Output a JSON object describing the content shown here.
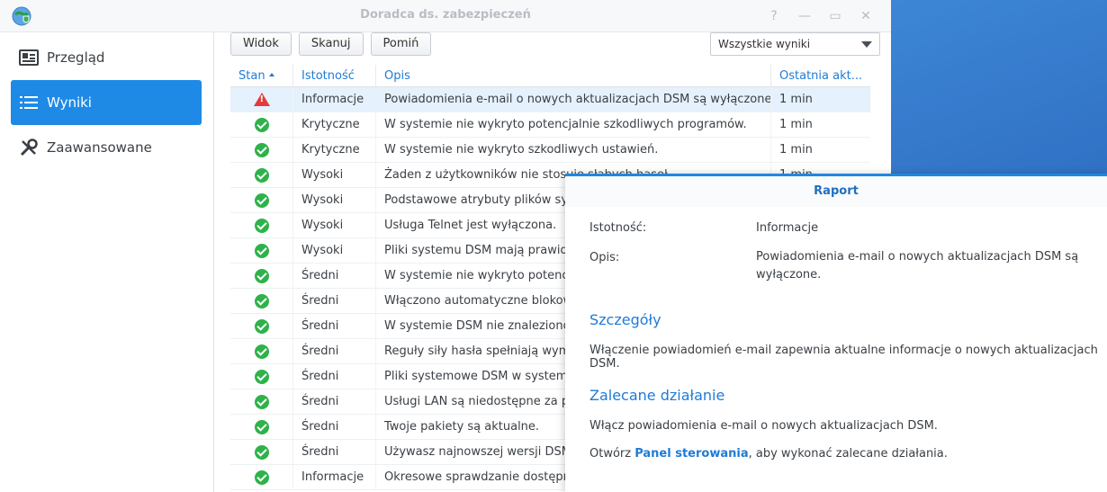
{
  "window": {
    "title": "Doradca ds. zabezpieczeń"
  },
  "sidebar": {
    "items": [
      {
        "label": "Przegląd",
        "icon": "overview-card-icon",
        "active": false
      },
      {
        "label": "Wyniki",
        "icon": "list-icon",
        "active": true
      },
      {
        "label": "Zaawansowane",
        "icon": "tools-icon",
        "active": false
      }
    ]
  },
  "toolbar": {
    "view_label": "Widok",
    "scan_label": "Skanuj",
    "skip_label": "Pomiń",
    "filter_value": "Wszystkie wyniki"
  },
  "table": {
    "headers": [
      "Stan",
      "Istotność",
      "Opis",
      "Ostatnia akt..."
    ],
    "rows": [
      {
        "status": "warning",
        "severity": "Informacje",
        "description": "Powiadomienia e-mail o nowych aktualizacjach DSM są wyłączone.",
        "last": "1 min"
      },
      {
        "status": "ok",
        "severity": "Krytyczne",
        "description": "W systemie nie wykryto potencjalnie szkodliwych programów.",
        "last": "1 min"
      },
      {
        "status": "ok",
        "severity": "Krytyczne",
        "description": "W systemie nie wykryto szkodliwych ustawień.",
        "last": "1 min"
      },
      {
        "status": "ok",
        "severity": "Wysoki",
        "description": "Żaden z użytkowników nie stosuje słabych haseł.",
        "last": "1 min"
      },
      {
        "status": "ok",
        "severity": "Wysoki",
        "description": "Podstawowe atrybuty plików systemowych",
        "last": ""
      },
      {
        "status": "ok",
        "severity": "Wysoki",
        "description": "Usługa Telnet jest wyłączona.",
        "last": ""
      },
      {
        "status": "ok",
        "severity": "Wysoki",
        "description": "Pliki systemu DSM mają prawidło",
        "last": ""
      },
      {
        "status": "ok",
        "severity": "Średni",
        "description": "W systemie nie wykryto potencja",
        "last": ""
      },
      {
        "status": "ok",
        "severity": "Średni",
        "description": "Włączono automatyczne blokowa",
        "last": ""
      },
      {
        "status": "ok",
        "severity": "Średni",
        "description": "W systemie DSM nie znaleziono",
        "last": ""
      },
      {
        "status": "ok",
        "severity": "Średni",
        "description": "Reguły siły hasła spełniają wymag",
        "last": ""
      },
      {
        "status": "ok",
        "severity": "Średni",
        "description": "Pliki systemowe DSM w systemow",
        "last": ""
      },
      {
        "status": "ok",
        "severity": "Średni",
        "description": "Usługi LAN są niedostępne za po",
        "last": ""
      },
      {
        "status": "ok",
        "severity": "Średni",
        "description": "Twoje pakiety są aktualne.",
        "last": ""
      },
      {
        "status": "ok",
        "severity": "Średni",
        "description": "Używasz najnowszej wersji DSM",
        "last": ""
      },
      {
        "status": "ok",
        "severity": "Informacje",
        "description": "Okresowe sprawdzanie dostępno",
        "last": ""
      }
    ]
  },
  "report": {
    "title": "Raport",
    "severity_label": "Istotność:",
    "severity_value": "Informacje",
    "description_label": "Opis:",
    "description_value": "Powiadomienia e-mail o nowych aktualizacjach DSM są wyłączone.",
    "details_heading": "Szczegóły",
    "details_text": "Włączenie powiadomień e-mail zapewnia aktualne informacje o nowych aktualizacjach DSM.",
    "recommended_heading": "Zalecane działanie",
    "recommended_text": "Włącz powiadomienia e-mail o nowych aktualizacjach DSM.",
    "open_prefix": "Otwórz ",
    "open_link": "Panel sterowania",
    "open_suffix": ", aby wykonać zalecane działania."
  },
  "colors": {
    "accent": "#1e8ae6",
    "ok": "#2eb24a",
    "warning": "#e23b3b",
    "link": "#1f7bd6"
  }
}
